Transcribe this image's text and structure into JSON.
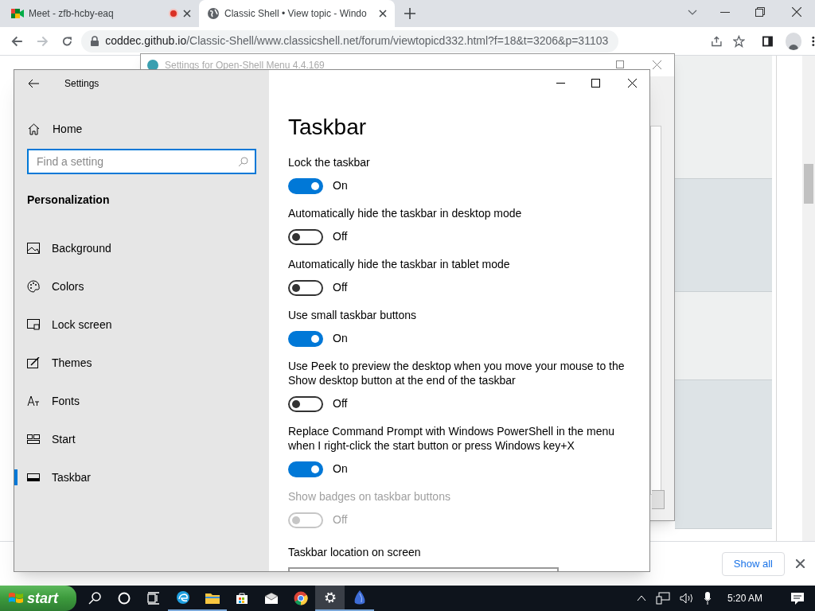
{
  "browser": {
    "tabs": [
      {
        "title": "Meet - zfb-hcby-eaq",
        "recording": true,
        "selected": false
      },
      {
        "title": "Classic Shell • View topic - Windo",
        "recording": false,
        "selected": true
      }
    ],
    "url_host": "coddec.github.io",
    "url_path": "/Classic-Shell/www.classicshell.net/forum/viewtopicd332.html?f=18&t=3206&p=31103"
  },
  "back_window": {
    "title": "Settings for Open-Shell Menu 4.4.169"
  },
  "settings": {
    "title": "Settings",
    "home": "Home",
    "search": {
      "placeholder": "Find a setting"
    },
    "section": "Personalization",
    "items": [
      {
        "label": "Background",
        "selected": false
      },
      {
        "label": "Colors",
        "selected": false
      },
      {
        "label": "Lock screen",
        "selected": false
      },
      {
        "label": "Themes",
        "selected": false
      },
      {
        "label": "Fonts",
        "selected": false
      },
      {
        "label": "Start",
        "selected": false
      },
      {
        "label": "Taskbar",
        "selected": true
      }
    ],
    "page_title": "Taskbar",
    "options": [
      {
        "label": "Lock the taskbar",
        "on": true,
        "disabled": false,
        "state": "On"
      },
      {
        "label": "Automatically hide the taskbar in desktop mode",
        "on": false,
        "disabled": false,
        "state": "Off"
      },
      {
        "label": "Automatically hide the taskbar in tablet mode",
        "on": false,
        "disabled": false,
        "state": "Off"
      },
      {
        "label": "Use small taskbar buttons",
        "on": true,
        "disabled": false,
        "state": "On"
      },
      {
        "label": "Use Peek to preview the desktop when you move your mouse to the Show desktop button at the end of the taskbar",
        "on": false,
        "disabled": false,
        "state": "Off"
      },
      {
        "label": "Replace Command Prompt with Windows PowerShell in the menu when I right-click the start button or press Windows key+X",
        "on": true,
        "disabled": false,
        "state": "On"
      },
      {
        "label": "Show badges on taskbar buttons",
        "on": false,
        "disabled": true,
        "state": "Off"
      }
    ],
    "next_heading": "Taskbar location on screen"
  },
  "download_bar": {
    "button": "Show all"
  },
  "taskbar": {
    "start": "start",
    "time": "5:20 AM"
  }
}
